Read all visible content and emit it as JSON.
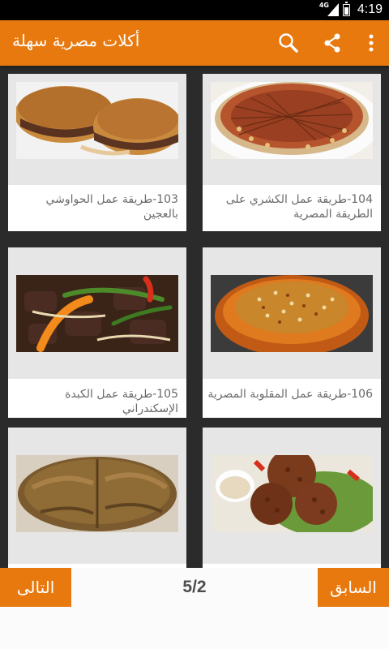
{
  "status_bar": {
    "time": "4:19",
    "network": "4G"
  },
  "app_bar": {
    "title": "أكلات مصرية سهلة",
    "actions": [
      "search-icon",
      "share-icon",
      "overflow-menu-icon"
    ]
  },
  "cards": [
    {
      "label": "103-طريقة عمل الحواوشي بالعجين",
      "image": "hawawshi"
    },
    {
      "label": "104-طريقة عمل الكشري على الطريقة المصرية",
      "image": "koshari"
    },
    {
      "label": "105-طريقة عمل الكبدة الإسكندراني",
      "image": "liver"
    },
    {
      "label": "106-طريقة عمل المقلوبة المصرية",
      "image": "maqluba"
    },
    {
      "label": "",
      "image": "flatbread"
    },
    {
      "label": "",
      "image": "falafel"
    }
  ],
  "pagination": {
    "next_label": "التالى",
    "prev_label": "السابق",
    "page_indicator": "5/2"
  },
  "colors": {
    "accent": "#e8790f",
    "background": "#2b2b2b",
    "card": "#ffffff"
  }
}
